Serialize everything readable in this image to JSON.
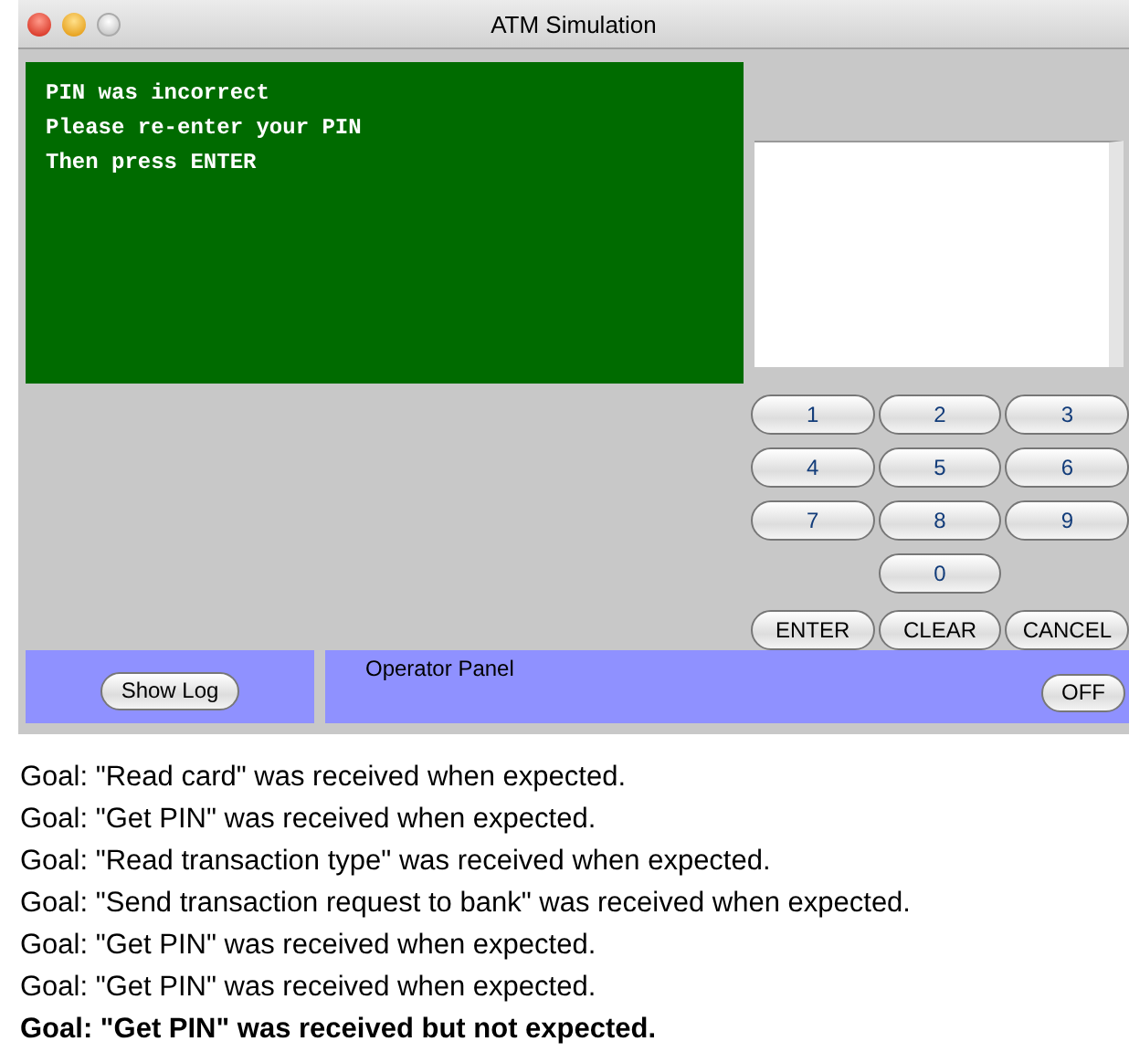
{
  "window": {
    "title": "ATM Simulation"
  },
  "display": {
    "lines": [
      "PIN was incorrect",
      "Please re-enter your PIN",
      "Then press ENTER"
    ]
  },
  "keypad": {
    "rows": [
      [
        "1",
        "2",
        "3"
      ],
      [
        "4",
        "5",
        "6"
      ],
      [
        "7",
        "8",
        "9"
      ],
      [
        "",
        "0",
        ""
      ],
      [
        "ENTER",
        "CLEAR",
        "CANCEL"
      ]
    ]
  },
  "operator_panel": {
    "show_log_button": "Show Log",
    "label": "Operator Panel",
    "power_button": "OFF"
  },
  "log": [
    {
      "text": "Goal: \"Read card\" was received when expected.",
      "kind": "ok"
    },
    {
      "text": "Goal: \"Get PIN\" was received when expected.",
      "kind": "ok"
    },
    {
      "text": "Goal: \"Read transaction type\" was received when expected.",
      "kind": "ok"
    },
    {
      "text": "Goal: \"Send transaction request to bank\" was received when expected.",
      "kind": "ok"
    },
    {
      "text": "Goal: \"Get PIN\" was received when expected.",
      "kind": "ok"
    },
    {
      "text": "Goal: \"Get PIN\" was received when expected.",
      "kind": "ok"
    },
    {
      "text": "Goal: \"Get PIN\" was received but not expected.",
      "kind": "error"
    }
  ]
}
